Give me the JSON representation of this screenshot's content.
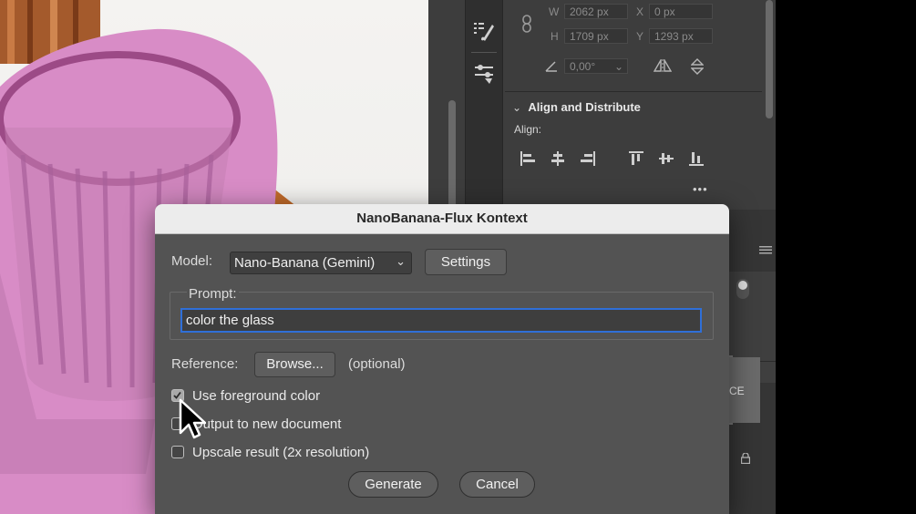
{
  "transform": {
    "w_label": "W",
    "w_value": "2062 px",
    "x_label": "X",
    "x_value": "0 px",
    "h_label": "H",
    "h_value": "1709 px",
    "y_label": "Y",
    "y_value": "1293 px",
    "angle_value": "0,00°"
  },
  "align_section": {
    "title": "Align and Distribute",
    "align_label": "Align:",
    "more": "•••"
  },
  "side_panel": {
    "truncated_text": "CE"
  },
  "dialog": {
    "title": "NanoBanana-Flux Kontext",
    "model_label": "Model:",
    "model_value": "Nano-Banana (Gemini)",
    "settings_button": "Settings",
    "prompt_legend": "Prompt:",
    "prompt_value": "color the glass",
    "reference_label": "Reference:",
    "browse_button": "Browse...",
    "optional_note": "(optional)",
    "checkboxes": [
      {
        "label": "Use foreground color",
        "checked": true
      },
      {
        "label": "Output to new document",
        "checked": false
      },
      {
        "label": "Upscale result (2x resolution)",
        "checked": false
      }
    ],
    "generate_button": "Generate",
    "cancel_button": "Cancel"
  },
  "colors": {
    "accent_focus": "#2f6fd8",
    "mask_pink": "#d88cc6",
    "glass_amber": "#c06a2a"
  }
}
